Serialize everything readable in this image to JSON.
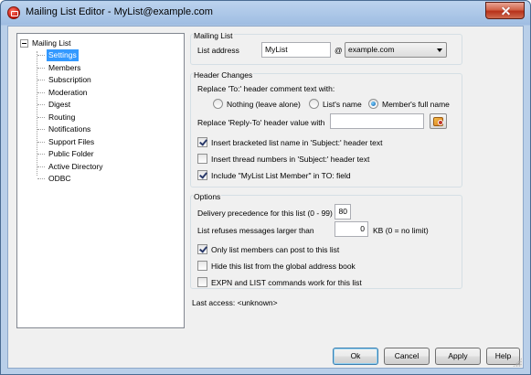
{
  "window": {
    "title": "Mailing List Editor - MyList@example.com"
  },
  "tree": {
    "root": "Mailing List",
    "items": [
      {
        "label": "Settings",
        "selected": true
      },
      {
        "label": "Members",
        "selected": false
      },
      {
        "label": "Subscription",
        "selected": false
      },
      {
        "label": "Moderation",
        "selected": false
      },
      {
        "label": "Digest",
        "selected": false
      },
      {
        "label": "Routing",
        "selected": false
      },
      {
        "label": "Notifications",
        "selected": false
      },
      {
        "label": "Support Files",
        "selected": false
      },
      {
        "label": "Public Folder",
        "selected": false
      },
      {
        "label": "Active Directory",
        "selected": false
      },
      {
        "label": "ODBC",
        "selected": false
      }
    ]
  },
  "mailing_list": {
    "title": "Mailing List",
    "address_label": "List address",
    "address_value": "MyList",
    "at_sign": "@",
    "domain_value": "example.com"
  },
  "header_changes": {
    "title": "Header Changes",
    "replace_to_label": "Replace 'To:' header comment text with:",
    "radio_nothing": "Nothing (leave alone)",
    "radio_list_name": "List's name",
    "radio_member_name": "Member's full name",
    "selected_radio": "member_name",
    "reply_to_label": "Replace 'Reply-To' header value with",
    "reply_to_value": "",
    "check_bracketed": "Insert bracketed list name in 'Subject:' header text",
    "check_thread": "Insert thread numbers in 'Subject:' header text",
    "check_include": "Include \"MyList List Member\" in TO: field",
    "bracketed_checked": true,
    "thread_checked": false,
    "include_checked": true
  },
  "options": {
    "title": "Options",
    "precedence_label": "Delivery precedence for this list (0 - 99)",
    "precedence_value": "80",
    "refuse_label": "List refuses messages larger than",
    "refuse_value": "0",
    "refuse_unit": "KB (0 = no limit)",
    "check_members_only": "Only list members can post to this list",
    "check_hide": "Hide this list from the global address book",
    "check_expn": "EXPN and LIST commands work for this list",
    "members_only_checked": true,
    "hide_checked": false,
    "expn_checked": false
  },
  "last_access": "Last access: <unknown>",
  "buttons": {
    "ok": "Ok",
    "cancel": "Cancel",
    "apply": "Apply",
    "help": "Help"
  }
}
